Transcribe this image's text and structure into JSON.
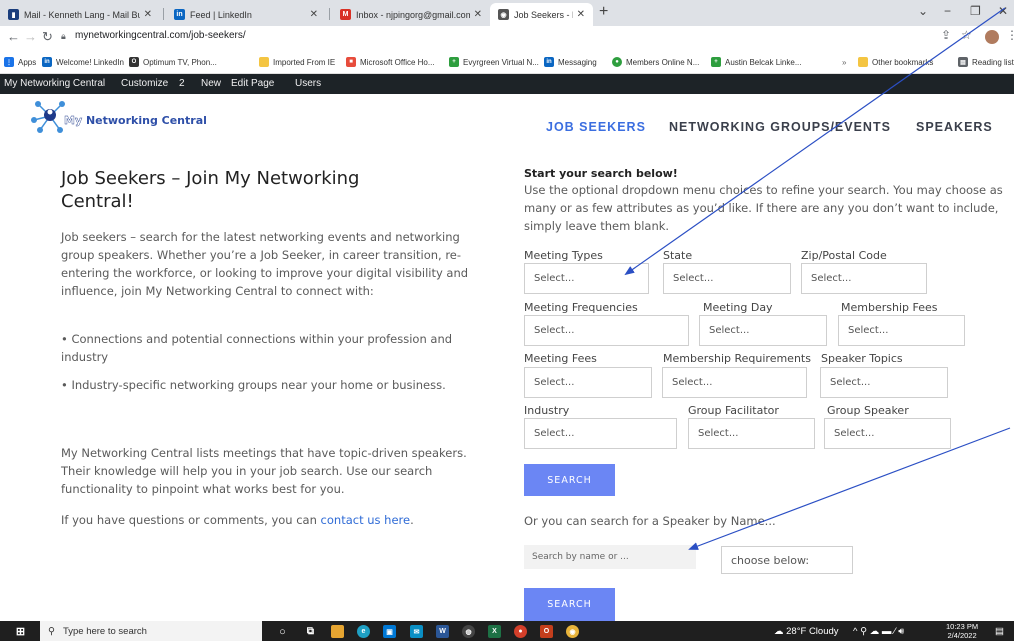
{
  "browser": {
    "tabs": [
      {
        "title": "Mail - Kenneth Lang - Mail Busin",
        "icon": "mail-icon",
        "color": "#1a3d7c",
        "glyph": "▮"
      },
      {
        "title": "Feed | LinkedIn",
        "icon": "linkedin-icon",
        "color": "#0a66c2",
        "glyph": "in"
      },
      {
        "title": "Inbox - njpingorg@gmail.com - ",
        "icon": "gmail-icon",
        "color": "#d93025",
        "glyph": "M"
      },
      {
        "title": "Job Seekers - My Networking Ce",
        "icon": "site-icon",
        "color": "#555555",
        "glyph": "◉"
      }
    ],
    "url": "mynetworkingcentral.com/job-seekers/",
    "bookmarks": [
      {
        "label": "Apps",
        "color": "#1a73e8",
        "glyph": "⋮"
      },
      {
        "label": "Welcome! LinkedIn",
        "color": "#0a66c2",
        "glyph": "in"
      },
      {
        "label": "Optimum TV, Phon...",
        "color": "#333333",
        "glyph": "O"
      },
      {
        "label": "Imported From IE",
        "color": "#f4c542",
        "glyph": ""
      },
      {
        "label": "Microsoft Office Ho...",
        "color": "#e74c3c",
        "glyph": "■"
      },
      {
        "label": "Evyrgreen Virtual N...",
        "color": "#2e9e3e",
        "glyph": "+"
      },
      {
        "label": "Messaging",
        "color": "#0a66c2",
        "glyph": "in"
      },
      {
        "label": "Members Online N...",
        "color": "#2e9e3e",
        "glyph": "●"
      },
      {
        "label": "Austin Belcak Linke...",
        "color": "#2e9e3e",
        "glyph": "+"
      },
      {
        "label": "Other bookmarks",
        "color": "#f4c542",
        "glyph": ""
      },
      {
        "label": "Reading list",
        "color": "#5f6368",
        "glyph": "▤"
      }
    ]
  },
  "adminbar": {
    "site": "My Networking Central",
    "customize": "Customize",
    "count": "2",
    "new": "New",
    "edit": "Edit Page",
    "users": "Users"
  },
  "header": {
    "logo_prefix": "My ",
    "logo_brand": "Networking Central",
    "nav": [
      "JOB SEEKERS",
      "NETWORKING GROUPS/EVENTS",
      "SPEAKERS"
    ]
  },
  "left": {
    "title": "Job Seekers – Join My Networking Central!",
    "intro": "Job seekers – search for the latest networking events and networking group speakers. Whether you’re a Job Seeker, in career transition, re-entering the workforce, or looking to improve your digital visibility and influence, join My Networking Central to connect with:",
    "bullet1": "• Connections and potential connections within your profession and industry",
    "bullet2": "• Industry-specific networking groups near your home or business.",
    "para2": "My Networking Central lists meetings that have topic-driven speakers. Their knowledge will help you in your job search. Use our search functionality to pinpoint what works best for you.",
    "contact_pre": "If you have questions or comments, you can ",
    "contact_link": "contact us here",
    "contact_post": "."
  },
  "search": {
    "title": "Start your search below!",
    "description": "Use the optional dropdown menu choices to refine your search. You may choose as many or as few attributes as you’d like. If there are any you don’t want to include, simply leave them blank.",
    "select_placeholder": "Select...",
    "fields": [
      "Meeting Types",
      "State",
      "Zip/Postal Code",
      "Meeting Frequencies",
      "Meeting Day",
      "Membership Fees",
      "Meeting Fees",
      "Membership Requirements",
      "Speaker Topics",
      "Industry",
      "Group Facilitator",
      "Group Speaker"
    ],
    "button": "SEARCH",
    "or_text": "Or you can search for a Speaker by Name...",
    "name_placeholder": "Search by name or ...",
    "choose": "choose below:",
    "button2": "SEARCH"
  },
  "taskbar": {
    "search_placeholder": "Type here to search",
    "weather": "28°F  Cloudy",
    "time": "10:23 PM",
    "date": "2/4/2022"
  },
  "annotation_color": "#2b4fc4"
}
